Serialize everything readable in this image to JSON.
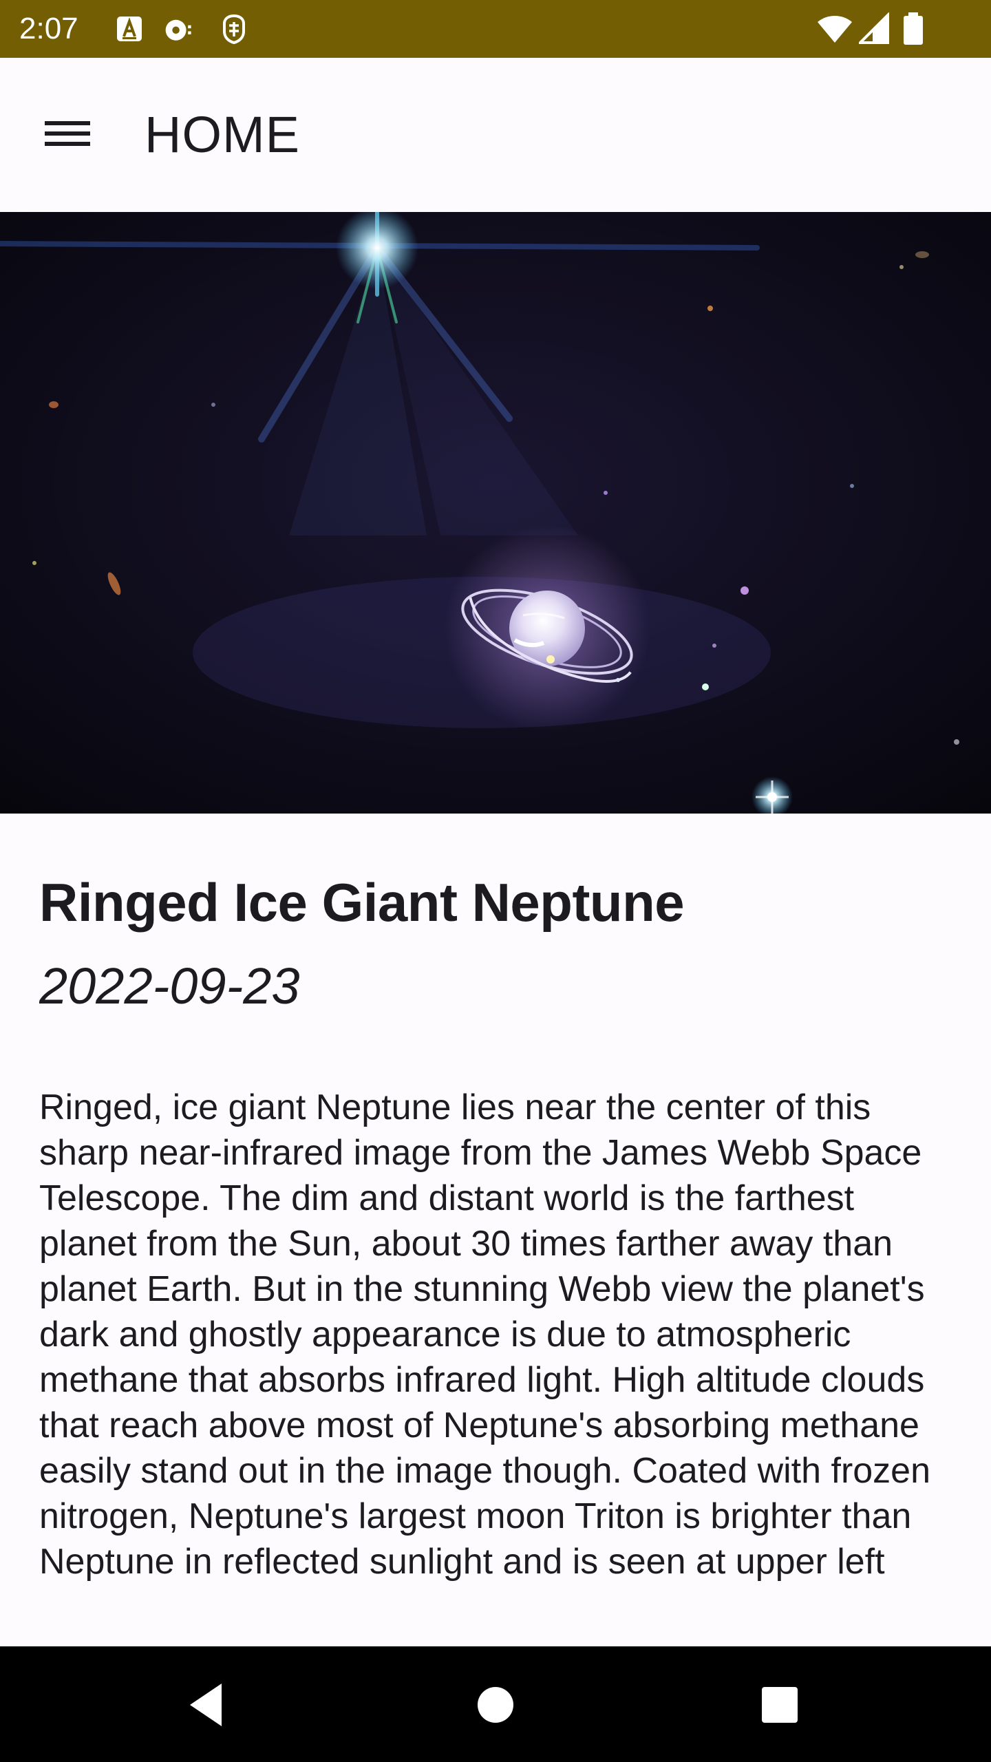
{
  "status_bar": {
    "time": "2:07",
    "notification_icons": [
      "a-badge-icon",
      "cast-icon",
      "shield-icon"
    ],
    "right_icons": [
      "wifi-icon",
      "cell-signal-icon",
      "battery-icon"
    ],
    "background": "#745e03"
  },
  "app_bar": {
    "menu_icon": "hamburger-menu-icon",
    "title": "HOME"
  },
  "article": {
    "image_alt": "Neptune with rings, James Webb near-infrared view",
    "title": "Ringed Ice Giant Neptune",
    "date": "2022-09-23",
    "explanation": "Ringed, ice giant Neptune lies near the center of this sharp near-infrared image from the James Webb Space Telescope. The dim and distant world is the farthest planet from the Sun, about 30 times farther away than planet Earth. But in the stunning Webb view the planet's dark and ghostly appearance is due to atmospheric methane that absorbs infrared light. High altitude clouds that reach above most of Neptune's absorbing methane easily stand out in the image though. Coated with frozen nitrogen, Neptune's largest moon Triton is brighter than Neptune in reflected sunlight and is seen at upper left"
  },
  "nav_bar": {
    "back": "back-icon",
    "home": "home-icon",
    "recents": "recents-icon"
  }
}
